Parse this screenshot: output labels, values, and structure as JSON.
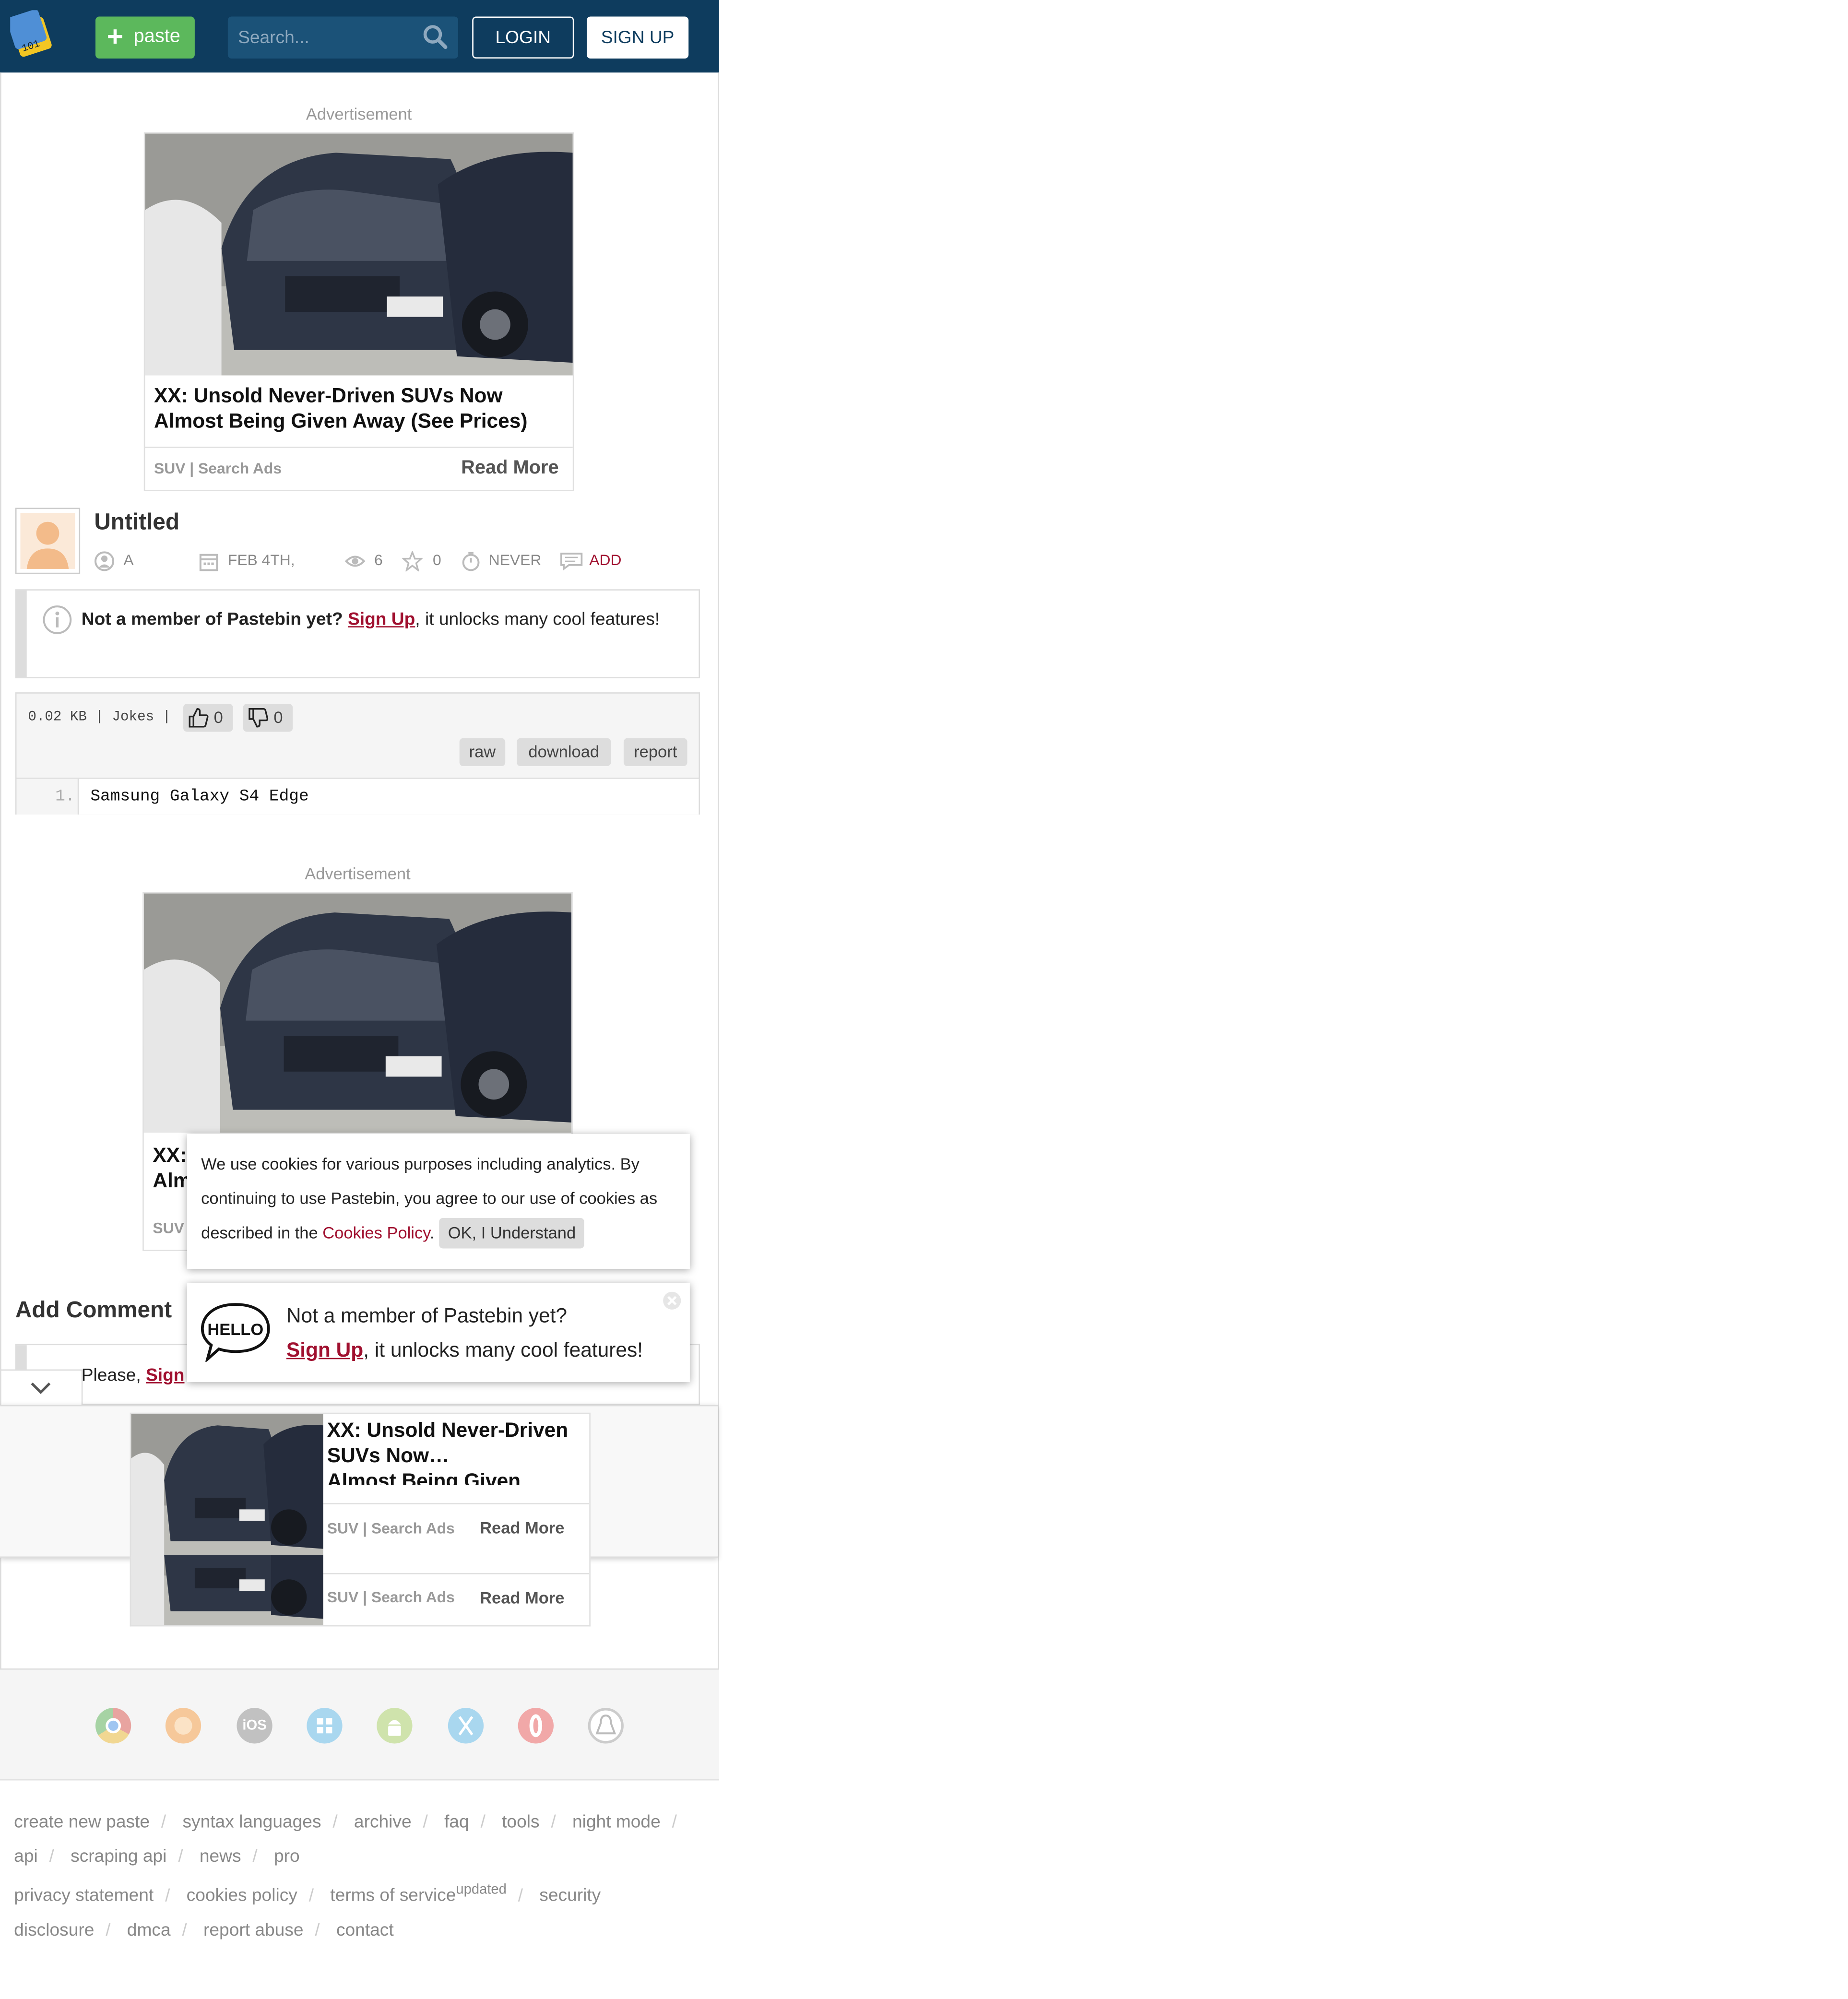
{
  "header": {
    "paste_label": "paste",
    "search_placeholder": "Search...",
    "login_label": "LOGIN",
    "signup_label": "SIGN UP"
  },
  "ads": [
    {
      "label": "Advertisement",
      "title": "XX: Unsold Never-Driven SUVs Now Almost Being Given Away (See Prices)",
      "source": "SUV | Search Ads",
      "cta": "Read More"
    },
    {
      "label": "Advertisement",
      "title_visible": "XX: Alm",
      "source_visible": "SUV"
    }
  ],
  "paste": {
    "title": "Untitled",
    "author": "A",
    "date": "FEB 4TH,",
    "views": "6",
    "stars": "0",
    "expires": "NEVER",
    "comment_action": "ADD",
    "size": "0.02 KB",
    "category": "Jokes",
    "likes": "0",
    "dislikes": "0",
    "actions": [
      "raw",
      "download",
      "report"
    ],
    "lines": [
      {
        "num": "1.",
        "text": "Samsung Galaxy S4 Edge"
      }
    ]
  },
  "member_notice": {
    "lead": "Not a member of Pastebin yet?",
    "link": "Sign Up",
    "rest": ", it unlocks many cool features!"
  },
  "comments": {
    "heading": "Add Comment",
    "prompt": "Please,",
    "link_visible": "Sign"
  },
  "cookie_banner": {
    "text_before": "We use cookies for various purposes including analytics. By continuing to use Pastebin, you agree to our use of cookies as described in the",
    "link": "Cookies Policy",
    "text_after": ".",
    "button": "OK, I Understand"
  },
  "hello_popup": {
    "badge": "HELLO",
    "lead": "Not a member of Pastebin yet?",
    "link": "Sign Up",
    "rest": ", it unlocks many cool features!"
  },
  "sticky_ad": {
    "title": "XX: Unsold Never-Driven SUVs Now…",
    "title_cut": "Almost Being Given",
    "source": "SUV | Search Ads",
    "cta": "Read More",
    "source2": "SUV | Search Ads",
    "cta2": "Read More"
  },
  "os_icons": [
    "chrome-icon",
    "firefox-icon",
    "ios-icon",
    "windows-icon",
    "android-icon",
    "macos-icon",
    "opera-icon",
    "linux-icon"
  ],
  "footer": {
    "links": [
      "create new paste",
      "syntax languages",
      "archive",
      "faq",
      "tools",
      "night mode",
      "api",
      "scraping api",
      "news",
      "pro",
      "privacy statement",
      "cookies policy",
      "terms of service",
      "security disclosure",
      "dmca",
      "report abuse",
      "contact"
    ],
    "updated_badge": "updated"
  },
  "colors": {
    "header_bg": "#0e3c5e",
    "paste_button": "#5cb85c",
    "link_red": "#a0102f"
  }
}
